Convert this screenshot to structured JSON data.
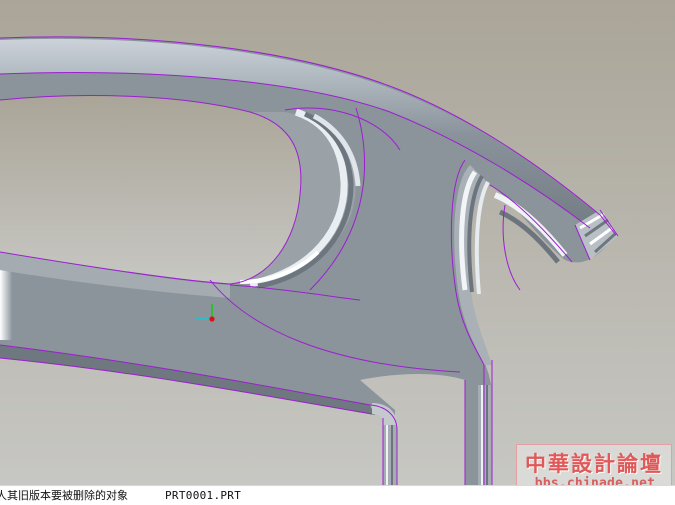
{
  "status": {
    "message": "人其旧版本要被删除的对象",
    "filename": "PRT0001.PRT"
  },
  "watermark": {
    "title": "中華設計論壇",
    "url": "bbs.chinade.net"
  },
  "colors": {
    "background_top": "#aaa598",
    "background_bottom": "#c7c7c3",
    "part_surface": "#8c949b",
    "edge_highlight": "#9b1fd0",
    "watermark_red": "#e05858"
  },
  "icons": [
    "coordinate-axis-icon"
  ]
}
